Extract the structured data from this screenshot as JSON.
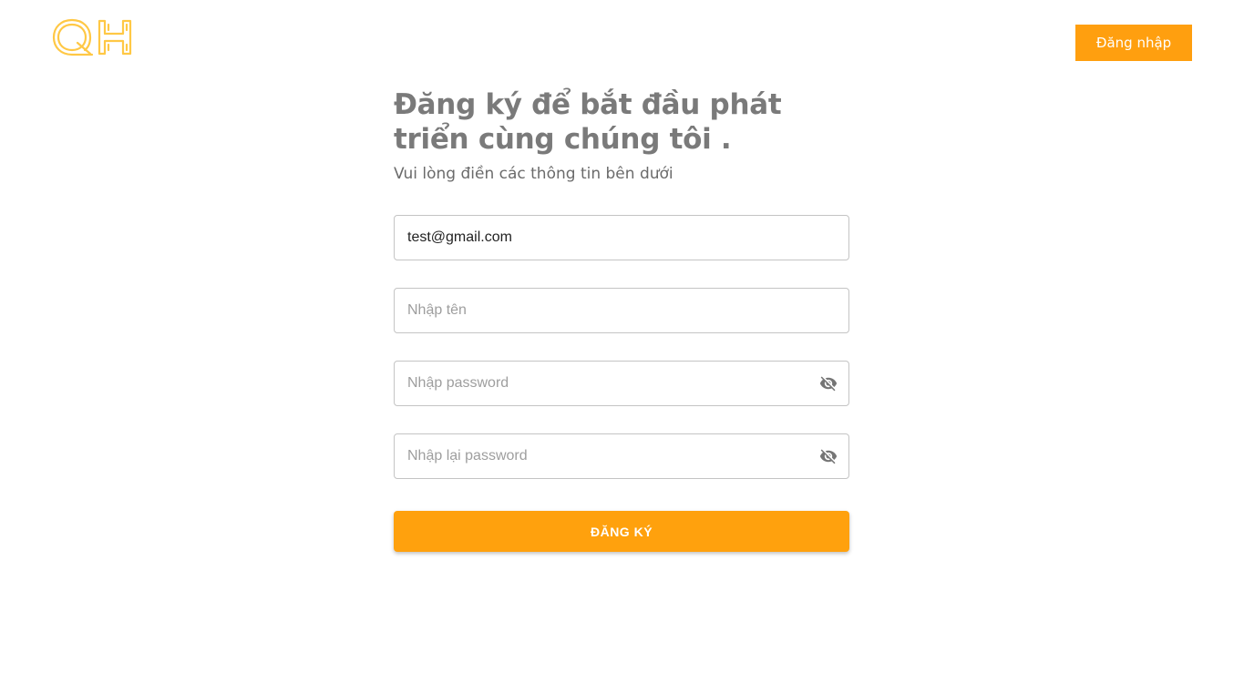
{
  "brand": {
    "logo_text": "QH",
    "accent_color": "#ffc845"
  },
  "header": {
    "login_label": "Đăng nhập",
    "button_color": "#ff9f0f"
  },
  "form": {
    "title": "Đăng ký để bắt đầu phát triển cùng chúng tôi .",
    "subtitle": "Vui lòng điền các thông tin bên dưới",
    "email": {
      "value": "test@gmail.com"
    },
    "name": {
      "placeholder": "Nhập tên"
    },
    "password": {
      "placeholder": "Nhập password",
      "icon": "eye-off-icon"
    },
    "confirm_password": {
      "placeholder": "Nhập lại password",
      "icon": "eye-off-icon"
    },
    "submit_label": "ĐĂNG KÝ",
    "submit_color": "#ffa10d"
  }
}
